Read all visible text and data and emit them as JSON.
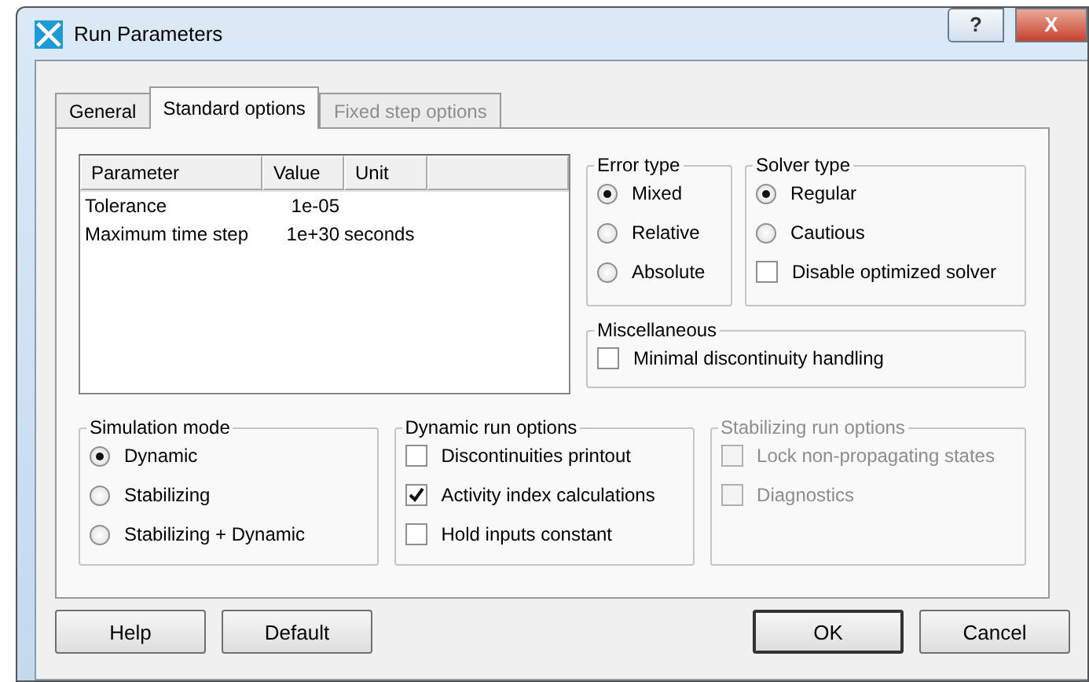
{
  "window": {
    "title": "Run Parameters",
    "title_buttons": [
      {
        "kind": "help",
        "label": "?"
      },
      {
        "kind": "close",
        "label": "X"
      }
    ]
  },
  "tabs": [
    {
      "label": "General",
      "selected": false,
      "disabled": false
    },
    {
      "label": "Standard options",
      "selected": true,
      "disabled": false
    },
    {
      "label": "Fixed step options",
      "selected": false,
      "disabled": true
    }
  ],
  "parameter_table": {
    "columns": [
      "Parameter",
      "Value",
      "Unit"
    ],
    "rows": [
      {
        "parameter": "Tolerance",
        "value": "1e-05"
      },
      {
        "parameter": "Maximum time step",
        "value": "1e+30",
        "unit": "seconds"
      }
    ]
  },
  "error_type": {
    "title": "Error type",
    "disabled": false,
    "items": [
      {
        "kind": "radio",
        "label": "Mixed",
        "selected": true,
        "disabled": false
      },
      {
        "kind": "radio",
        "label": "Relative",
        "selected": false,
        "disabled": false
      },
      {
        "kind": "radio",
        "label": "Absolute",
        "selected": false,
        "disabled": false
      }
    ]
  },
  "solver_type": {
    "title": "Solver type",
    "disabled": false,
    "items": [
      {
        "kind": "radio",
        "label": "Regular",
        "selected": true,
        "disabled": false
      },
      {
        "kind": "radio",
        "label": "Cautious",
        "selected": false,
        "disabled": false
      },
      {
        "kind": "checkbox",
        "label": "Disable optimized solver",
        "checked": false,
        "disabled": false
      }
    ]
  },
  "miscellaneous": {
    "title": "Miscellaneous",
    "disabled": false,
    "items": [
      {
        "kind": "checkbox",
        "label": "Minimal discontinuity handling",
        "checked": false,
        "disabled": false
      }
    ]
  },
  "simulation_mode": {
    "title": "Simulation mode",
    "disabled": false,
    "items": [
      {
        "kind": "radio",
        "label": "Dynamic",
        "selected": true,
        "disabled": false
      },
      {
        "kind": "radio",
        "label": "Stabilizing",
        "selected": false,
        "disabled": false
      },
      {
        "kind": "radio",
        "label": "Stabilizing + Dynamic",
        "selected": false,
        "disabled": false
      }
    ]
  },
  "dynamic_run_options": {
    "title": "Dynamic run options",
    "disabled": false,
    "items": [
      {
        "kind": "checkbox",
        "label": "Discontinuities printout",
        "checked": false,
        "disabled": false
      },
      {
        "kind": "checkbox",
        "label": "Activity index calculations",
        "checked": true,
        "disabled": false
      },
      {
        "kind": "checkbox",
        "label": "Hold inputs constant",
        "checked": false,
        "disabled": false
      }
    ]
  },
  "stabilizing_run_options": {
    "title": "Stabilizing run options",
    "disabled": true,
    "items": [
      {
        "kind": "checkbox",
        "label": "Lock non-propagating states",
        "checked": false,
        "disabled": true
      },
      {
        "kind": "checkbox",
        "label": "Diagnostics",
        "checked": false,
        "disabled": true
      }
    ]
  },
  "buttons": [
    {
      "label": "Help",
      "default": false
    },
    {
      "label": "Default",
      "default": false
    },
    {
      "label": "OK",
      "default": true
    },
    {
      "label": "Cancel",
      "default": false
    }
  ]
}
